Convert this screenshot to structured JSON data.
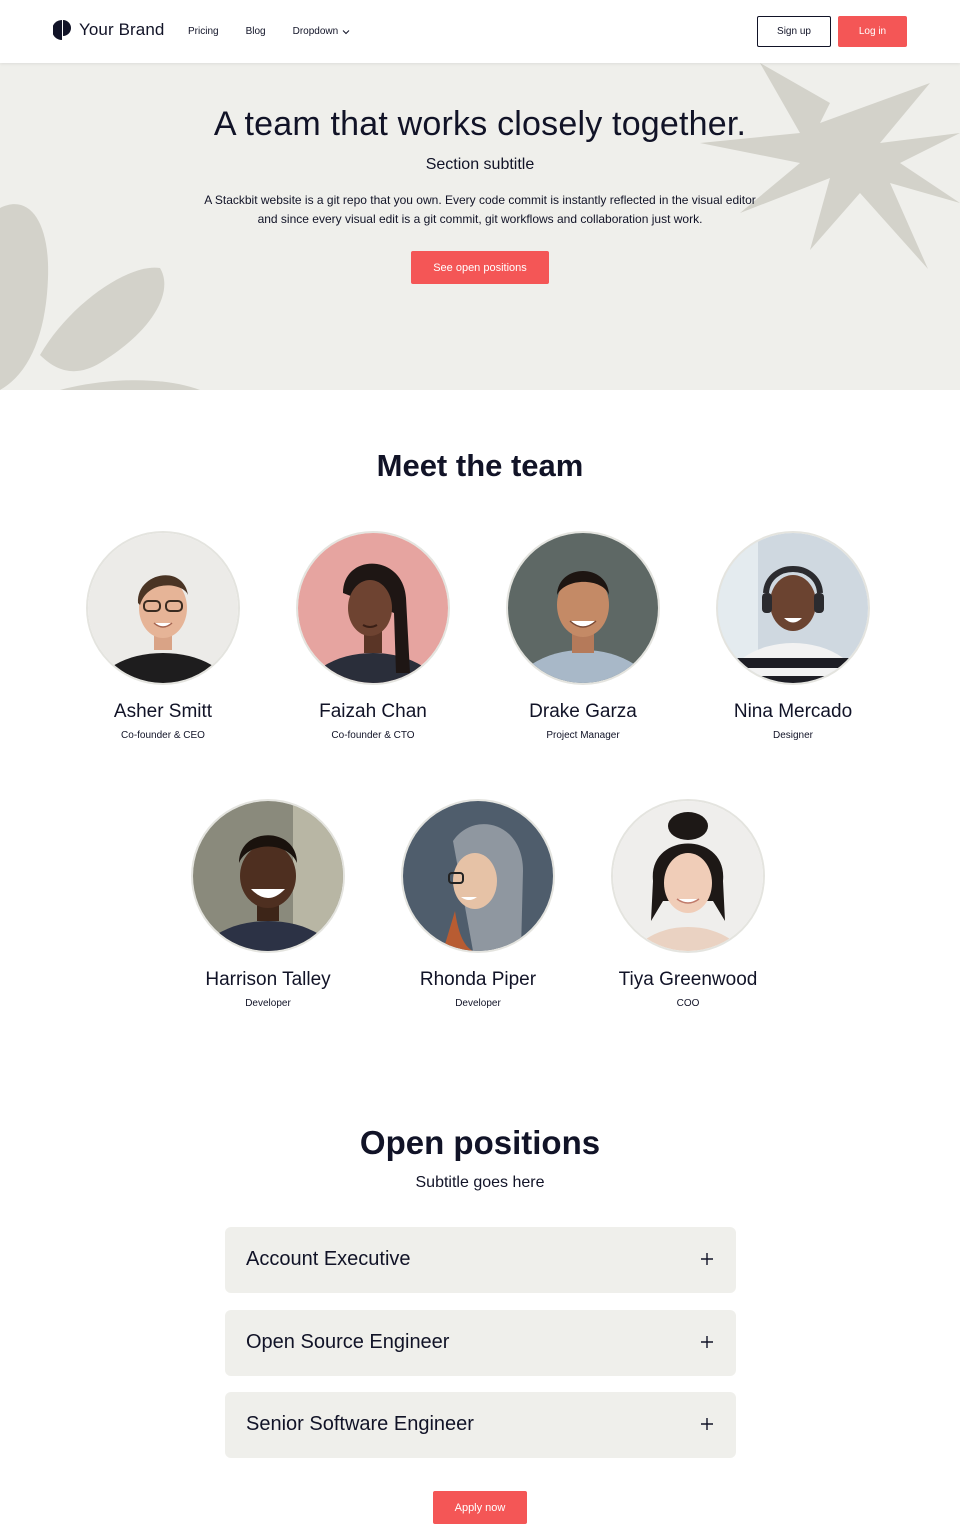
{
  "colors": {
    "accent": "#f45656",
    "hero_bg": "#efefeb",
    "decor": "#d3d2ca",
    "text": "#111327",
    "card_bg": "#efefeb"
  },
  "header": {
    "brand": "Your Brand",
    "brand_icon": "brand-logo-icon",
    "nav": [
      {
        "label": "Pricing"
      },
      {
        "label": "Blog"
      },
      {
        "label": "Dropdown",
        "icon": "chevron-down-icon"
      }
    ],
    "signup_label": "Sign up",
    "login_label": "Log in"
  },
  "hero": {
    "title": "A team that works closely together.",
    "subtitle": "Section subtitle",
    "text": "A Stackbit website is a git repo that you own. Every code commit is instantly reflected in the visual editor and since every visual edit is a git commit, git workflows and collaboration just work.",
    "button_label": "See open positions"
  },
  "team": {
    "title": "Meet the team",
    "members": [
      {
        "name": "Asher Smitt",
        "role": "Co-founder & CEO"
      },
      {
        "name": "Faizah Chan",
        "role": "Co-founder & CTO"
      },
      {
        "name": "Drake Garza",
        "role": "Project Manager"
      },
      {
        "name": "Nina Mercado",
        "role": "Designer"
      },
      {
        "name": "Harrison Talley",
        "role": "Developer"
      },
      {
        "name": "Rhonda Piper",
        "role": "Developer"
      },
      {
        "name": "Tiya Greenwood",
        "role": "COO"
      }
    ]
  },
  "positions": {
    "title": "Open positions",
    "subtitle": "Subtitle goes here",
    "jobs": [
      {
        "title": "Account Executive",
        "icon": "plus-icon"
      },
      {
        "title": "Open Source Engineer",
        "icon": "plus-icon"
      },
      {
        "title": "Senior Software Engineer",
        "icon": "plus-icon"
      }
    ],
    "apply_label": "Apply now"
  }
}
